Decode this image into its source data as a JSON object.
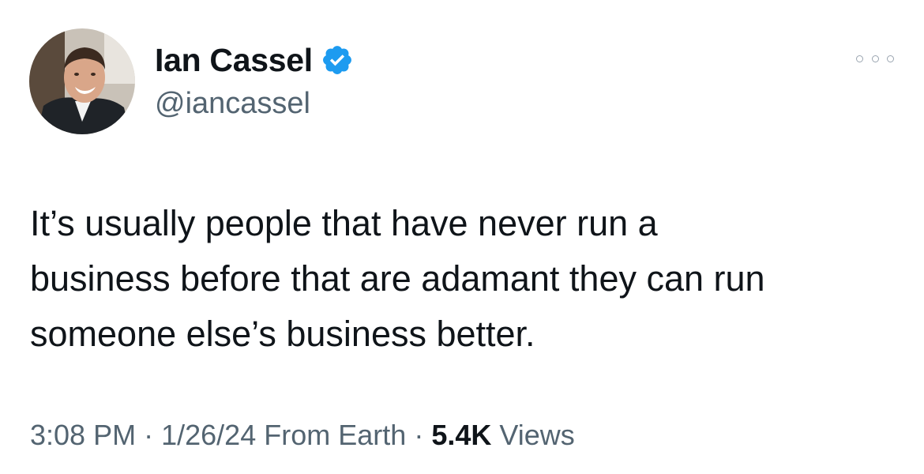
{
  "author": {
    "display_name": "Ian Cassel",
    "handle": "@iancassel",
    "verified": true,
    "avatar_icon": "profile-photo",
    "verified_icon": "verified-badge-icon",
    "verified_color": "#1d9bf0"
  },
  "more_icon": "more-options-icon",
  "tweet": {
    "lines": [
      "It’s usually people that have never run a",
      "business before that are adamant they can run",
      "someone else’s business better."
    ]
  },
  "meta": {
    "time": "3:08 PM",
    "separator": "·",
    "date": "1/26/24",
    "source": "From Earth",
    "views_count": "5.4K",
    "views_label": "Views"
  },
  "colors": {
    "text_primary": "#0f1419",
    "text_secondary": "#536471",
    "background": "#ffffff"
  }
}
